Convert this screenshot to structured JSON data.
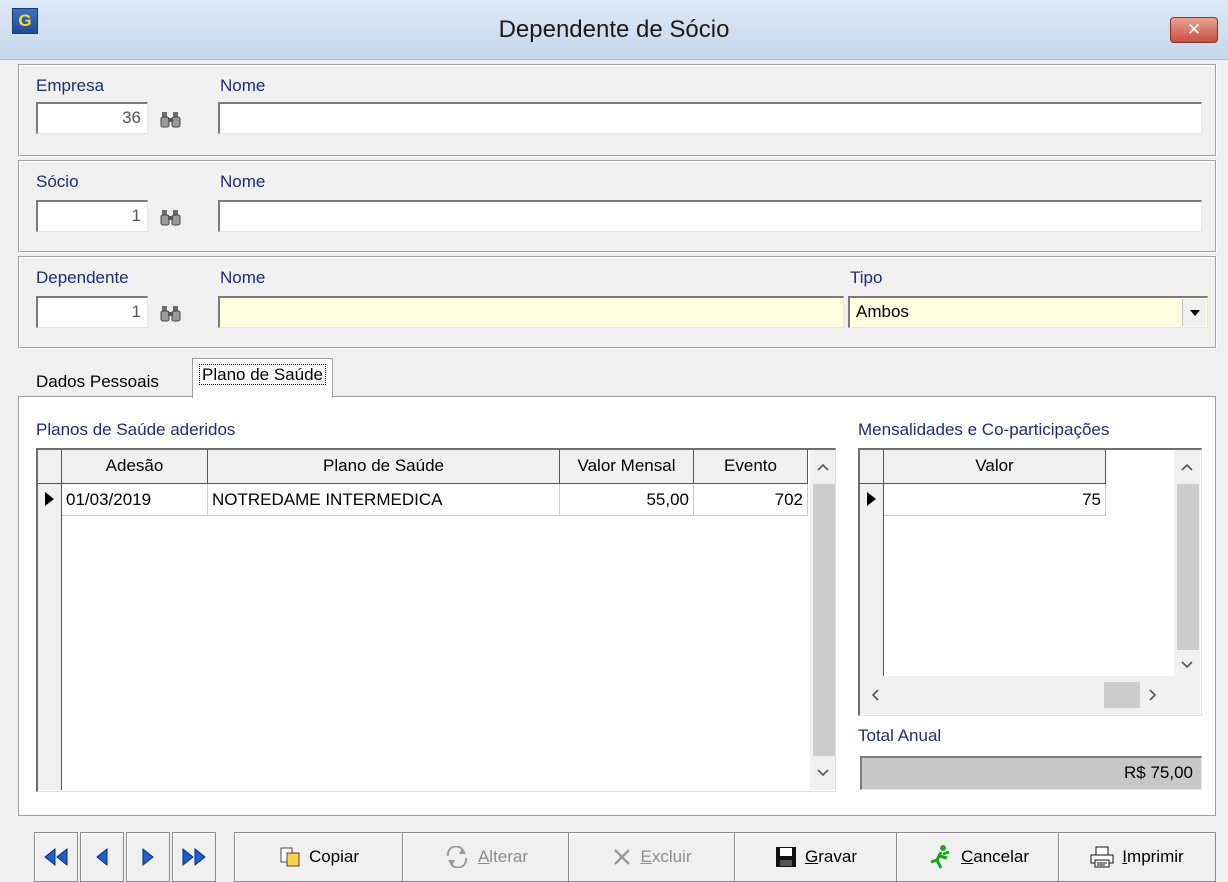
{
  "window": {
    "title": "Dependente de Sócio",
    "icon": "app-logo-icon",
    "close": "✕"
  },
  "empresa": {
    "label": "Empresa",
    "code": "36",
    "name_label": "Nome",
    "name_value": ""
  },
  "socio": {
    "label": "Sócio",
    "code": "1",
    "name_label": "Nome",
    "name_value": ""
  },
  "dependente": {
    "label": "Dependente",
    "code": "1",
    "name_label": "Nome",
    "name_value": "",
    "tipo_label": "Tipo",
    "tipo_value": "Ambos"
  },
  "tabs": [
    {
      "label": "Dados Pessoais",
      "active": false
    },
    {
      "label": "Plano de Saúde",
      "active": true
    }
  ],
  "planos": {
    "title": "Planos de Saúde aderidos",
    "columns": [
      "Adesão",
      "Plano de Saúde",
      "Valor Mensal",
      "Evento"
    ],
    "rows": [
      {
        "adesao": "01/03/2019",
        "plano": "NOTREDAME INTERMEDICA",
        "valor": "55,00",
        "evento": "702"
      }
    ]
  },
  "mensalidades": {
    "title": "Mensalidades e Co-participações",
    "columns": [
      "Valor"
    ],
    "rows": [
      {
        "valor": "75"
      }
    ],
    "total_label": "Total Anual",
    "total_value": "R$ 75,00"
  },
  "toolbar": {
    "nav_icons": [
      "first-record-icon",
      "prev-record-icon",
      "next-record-icon",
      "last-record-icon"
    ],
    "copiar": "Copiar",
    "alterar_u": "A",
    "alterar_rest": "lterar",
    "excluir_u": "E",
    "excluir_rest": "xcluir",
    "gravar_u": "G",
    "gravar_rest": "ravar",
    "cancelar_u": "C",
    "cancelar_rest": "ancelar",
    "imprimir_u": "I",
    "imprimir_rest": "mprimir"
  },
  "colors": {
    "label_blue": "#1c2c78",
    "required_yellow": "#ffffe1",
    "nav_blue": "#1f5fd0"
  }
}
